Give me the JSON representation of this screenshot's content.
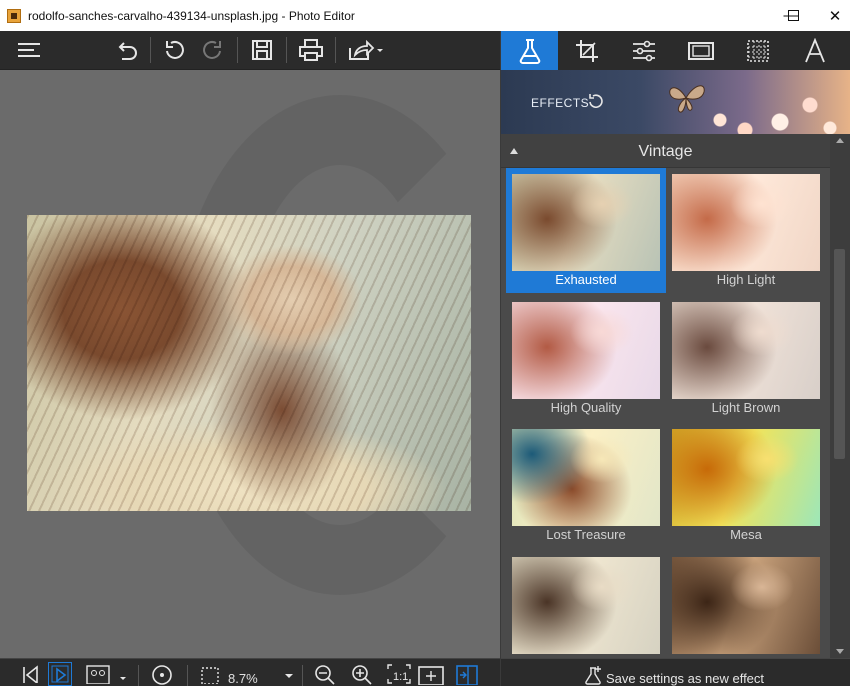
{
  "window": {
    "title": "rodolfo-sanches-carvalho-439134-unsplash.jpg - Photo Editor",
    "controls": [
      "—",
      "☐",
      "✕"
    ]
  },
  "toolbar": {
    "icons": [
      "menu-icon",
      "undo-icon",
      "undo-step-icon",
      "redo-icon",
      "save-icon",
      "print-icon",
      "share-icon"
    ]
  },
  "bottom_bar": {
    "zoom": "8.7%",
    "icons": [
      "first-image-icon",
      "slideshow-icon",
      "compare-icon",
      "rotate-icon",
      "zoom-field-icon",
      "zoom-out-icon",
      "zoom-in-icon",
      "actual-size-icon",
      "fit-icon",
      "side-panel-icon"
    ]
  },
  "right_panel": {
    "tabs": [
      "effects-icon",
      "crop-icon",
      "adjust-icon",
      "frame-icon",
      "texture-icon",
      "text-icon"
    ],
    "active_tab": "effects",
    "banner_label": "EFFECTS",
    "section": "Vintage",
    "effects": [
      {
        "label": "Exhausted",
        "selected": true
      },
      {
        "label": "High Light",
        "selected": false
      },
      {
        "label": "High Quality",
        "selected": false
      },
      {
        "label": "Light Brown",
        "selected": false
      },
      {
        "label": "Lost Treasure",
        "selected": false
      },
      {
        "label": "Mesa",
        "selected": false
      },
      {
        "label": "",
        "selected": false
      },
      {
        "label": "",
        "selected": false
      }
    ],
    "save_label": "Save settings as new effect"
  },
  "colors": {
    "accent": "#1f7ad6",
    "panel": "#4a4a4a",
    "toolbar": "#2b2b2b",
    "canvas": "#6b6b6b"
  }
}
